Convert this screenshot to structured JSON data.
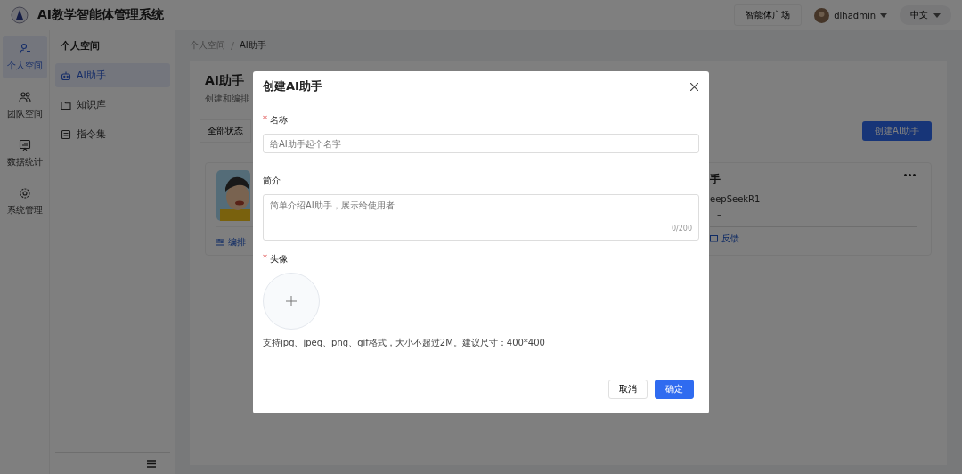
{
  "header": {
    "title": "AI教学智能体管理系统",
    "market_button": "智能体广场",
    "user": {
      "name": "dlhadmin"
    },
    "language": "中文"
  },
  "rail": [
    {
      "label": "个人空间",
      "selected": true,
      "kind": "person"
    },
    {
      "label": "团队空间",
      "selected": false,
      "kind": "team"
    },
    {
      "label": "数据统计",
      "selected": false,
      "kind": "stats"
    },
    {
      "label": "系统管理",
      "selected": false,
      "kind": "gear"
    }
  ],
  "sidebar": {
    "heading": "个人空间",
    "items": [
      {
        "label": "AI助手",
        "selected": true,
        "kind": "robot"
      },
      {
        "label": "知识库",
        "selected": false,
        "kind": "folder"
      },
      {
        "label": "指令集",
        "selected": false,
        "kind": "list"
      }
    ]
  },
  "breadcrumb": [
    "个人空间",
    "AI助手"
  ],
  "content": {
    "title": "AI助手",
    "subtitle": "创建和编排",
    "filter": "全部状态",
    "create_button": "创建AI助手",
    "card": {
      "edit_link": "编排",
      "name": "手",
      "model": "eepSeekR1",
      "value": "–",
      "feedback_link": "反馈"
    }
  },
  "modal": {
    "title": "创建AI助手",
    "fields": [
      {
        "kind": "input",
        "label": "名称",
        "required": true,
        "placeholder": "给AI助手起个名字"
      },
      {
        "kind": "textarea",
        "label": "简介",
        "required": false,
        "placeholder": "简单介绍AI助手，展示给使用者",
        "counter": "0/200"
      },
      {
        "kind": "upload",
        "label": "头像",
        "required": true,
        "hint": "支持jpg、jpeg、png、gif格式，大小不超过2M。建议尺寸：400*400"
      }
    ],
    "buttons": [
      {
        "label": "取消",
        "kind": "default"
      },
      {
        "label": "确定",
        "kind": "primary"
      }
    ]
  }
}
